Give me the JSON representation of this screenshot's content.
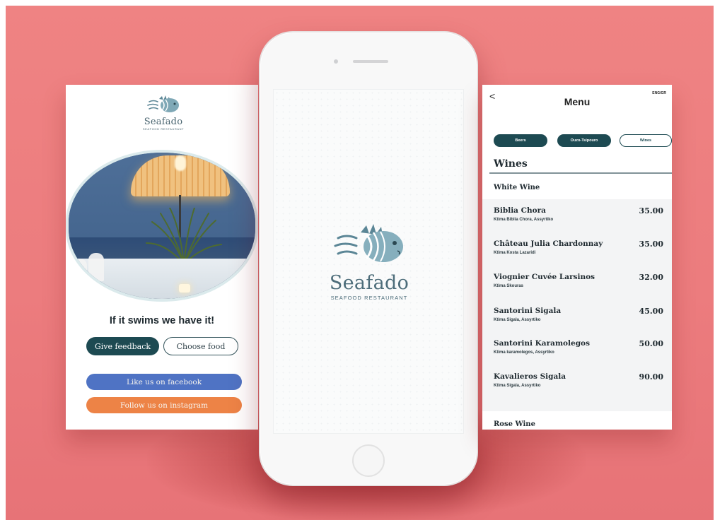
{
  "colors": {
    "background": "#ec7c7e",
    "accent_dark_teal": "#1d4a52",
    "logo_blue": "#4d6d7a",
    "facebook_blue": "#4f73c4",
    "instagram_orange": "#ed8346"
  },
  "left_screen": {
    "brand": "Seafado",
    "brand_sub": "SEAFOOD RESTAURANT",
    "tagline": "If it swims we have it!",
    "give_feedback": "Give feedback",
    "choose_food": "Choose food",
    "facebook": "Like us on facebook",
    "instagram": "Follow us on instagram",
    "logo_icon": "fish-logo-icon"
  },
  "phone": {
    "brand": "Seafado",
    "brand_sub": "SEAFOOD RESTAURANT",
    "logo_icon": "fish-logo-icon"
  },
  "menu_screen": {
    "back": "<",
    "title": "Menu",
    "lang": "ENG/GR",
    "tabs": [
      "Beers",
      "Ouzo-Tsipouro",
      "Wines"
    ],
    "section": "Wines",
    "group_white": "White Wine",
    "group_rose": "Rose Wine",
    "items": [
      {
        "name": "Biblia Chora",
        "desc": "Ktima Biblia Chora, Assyrtiko",
        "price": "35.00"
      },
      {
        "name": "Château Julia Chardonnay",
        "desc": "Ktima Kosta Lazaridi",
        "price": "35.00"
      },
      {
        "name": "Viognier Cuvée Larsinos",
        "desc": "Ktima Skouras",
        "price": "32.00"
      },
      {
        "name": "Santorini Sigala",
        "desc": "Ktima Sigala, Assyrtiko",
        "price": "45.00"
      },
      {
        "name": "Santorini Karamolegos",
        "desc": "Ktima karamolegos, Assyrtiko",
        "price": "50.00"
      },
      {
        "name": "Kavalieros Sigala",
        "desc": "Ktima Sigala, Assyrtiko",
        "price": "90.00"
      }
    ]
  }
}
